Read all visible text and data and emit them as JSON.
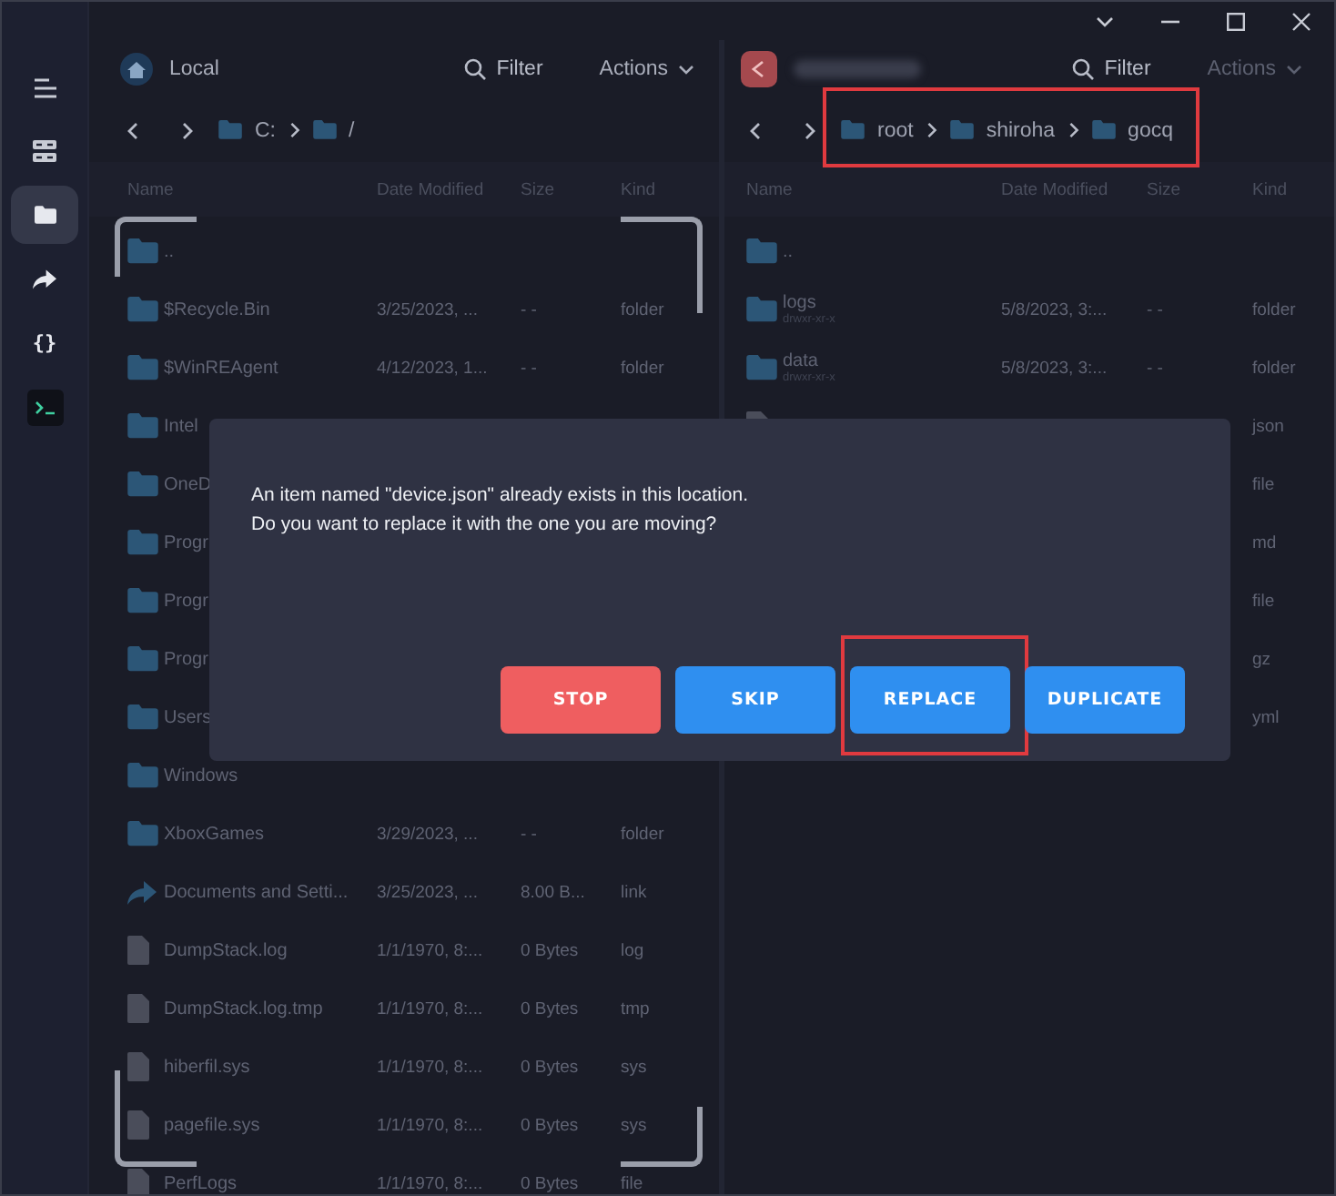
{
  "sidebar": {
    "items": [
      {
        "kind": "menu",
        "selected": false
      },
      {
        "kind": "servers",
        "selected": false
      },
      {
        "kind": "folder",
        "selected": true
      },
      {
        "kind": "share",
        "selected": false
      },
      {
        "kind": "braces",
        "label": "{}",
        "selected": false
      },
      {
        "kind": "terminal",
        "selected": false
      }
    ]
  },
  "panels": [
    {
      "kind": "local",
      "title": "Local",
      "filter": "Filter",
      "actions": {
        "label": "Actions",
        "disabled": false
      },
      "breadcrumb": {
        "highlighted": false,
        "items": [
          "C:",
          "/"
        ]
      },
      "columns": [
        "Name",
        "Date Modified",
        "Size",
        "Kind"
      ],
      "selection_frame": true,
      "rows": [
        {
          "kind": "folder",
          "name": ".."
        },
        {
          "kind": "folder",
          "name": "$Recycle.Bin",
          "date": "3/25/2023, ...",
          "size": "- -",
          "type": "folder"
        },
        {
          "kind": "folder",
          "name": "$WinREAgent",
          "date": "4/12/2023, 1...",
          "size": "- -",
          "type": "folder"
        },
        {
          "kind": "folder",
          "name": "Intel"
        },
        {
          "kind": "folder",
          "name": "OneD"
        },
        {
          "kind": "folder",
          "name": "Progr"
        },
        {
          "kind": "folder",
          "name": "Progr"
        },
        {
          "kind": "folder",
          "name": "Progr"
        },
        {
          "kind": "folder",
          "name": "Users"
        },
        {
          "kind": "folder",
          "name": "Windows"
        },
        {
          "kind": "folder",
          "name": "XboxGames",
          "date": "3/29/2023, ...",
          "size": "- -",
          "type": "folder"
        },
        {
          "kind": "link",
          "name": "Documents and Setti...",
          "date": "3/25/2023, ...",
          "size": "8.00 B...",
          "type": "link"
        },
        {
          "kind": "file",
          "name": "DumpStack.log",
          "date": "1/1/1970, 8:...",
          "size": "0 Bytes",
          "type": "log"
        },
        {
          "kind": "file",
          "name": "DumpStack.log.tmp",
          "date": "1/1/1970, 8:...",
          "size": "0 Bytes",
          "type": "tmp"
        },
        {
          "kind": "file",
          "name": "hiberfil.sys",
          "date": "1/1/1970, 8:...",
          "size": "0 Bytes",
          "type": "sys"
        },
        {
          "kind": "file",
          "name": "pagefile.sys",
          "date": "1/1/1970, 8:...",
          "size": "0 Bytes",
          "type": "sys"
        },
        {
          "kind": "file",
          "name": "PerfLogs",
          "date": "1/1/1970, 8:...",
          "size": "0 Bytes",
          "type": "file"
        }
      ]
    },
    {
      "kind": "remote",
      "filter": "Filter",
      "actions": {
        "label": "Actions",
        "disabled": true
      },
      "breadcrumb": {
        "highlighted": true,
        "items": [
          "root",
          "shiroha",
          "gocq"
        ]
      },
      "columns": [
        "Name",
        "Date Modified",
        "Size",
        "Kind"
      ],
      "selection_frame": false,
      "rows": [
        {
          "kind": "folder",
          "name": ".."
        },
        {
          "kind": "folder",
          "name": "logs",
          "meta": "drwxr-xr-x",
          "date": "5/8/2023, 3:...",
          "size": "- -",
          "type": "folder"
        },
        {
          "kind": "folder",
          "name": "data",
          "meta": "drwxr-xr-x",
          "date": "5/8/2023, 3:...",
          "size": "- -",
          "type": "folder"
        },
        {
          "kind": "file",
          "type": "json"
        },
        {
          "type": "file"
        },
        {
          "type": "md"
        },
        {
          "type": "file"
        },
        {
          "type": "gz"
        },
        {
          "type": "yml"
        }
      ]
    }
  ],
  "dialog": {
    "message": "An item named \"device.json\" already exists in this location.\nDo you want to replace it with the one you are moving?",
    "buttons": [
      {
        "label": "STOP",
        "kind": "danger",
        "highlighted": false
      },
      {
        "label": "SKIP",
        "kind": "primary",
        "highlighted": false
      },
      {
        "label": "REPLACE",
        "kind": "primary",
        "highlighted": true
      },
      {
        "label": "DUPLICATE",
        "kind": "primary",
        "highlighted": false
      }
    ]
  }
}
